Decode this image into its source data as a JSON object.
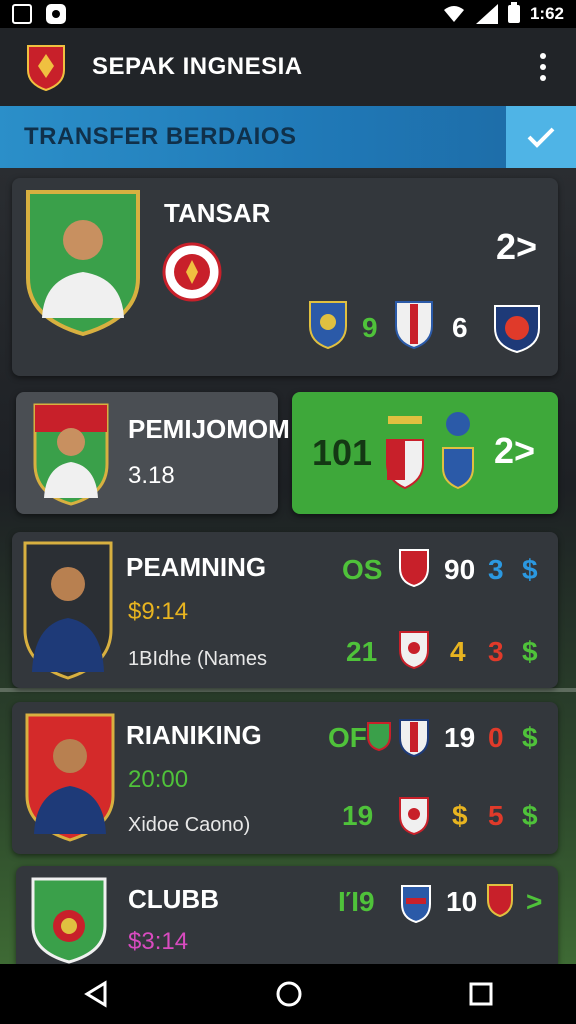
{
  "status_bar": {
    "time": "1:62"
  },
  "app": {
    "title": "SEPAK INGNESIA"
  },
  "banner": {
    "title": "TRANSFER BERDAIOS"
  },
  "cards": [
    {
      "name": "TANSAR",
      "arrow": "2>",
      "stats": [
        "9",
        "6"
      ]
    },
    {
      "name": "PEMIJOMOM",
      "value": "3.18",
      "score": "101",
      "arrow": "2>"
    },
    {
      "name": "PEAMNING",
      "value": "$9:14",
      "note": "1BIdhe (Names",
      "row1": [
        "OS",
        "90",
        "3",
        "$"
      ],
      "row2": [
        "21",
        "4",
        "3",
        "$"
      ]
    },
    {
      "name": "RIANIKING",
      "value": "20:00",
      "note": "Xidoe Caono)",
      "row1": [
        "OF",
        "19",
        "0",
        "$"
      ],
      "row2": [
        "19",
        "$",
        "5",
        "$"
      ]
    },
    {
      "name": "CLUBB",
      "value": "$3:14",
      "row1": [
        "IΊ9",
        "10",
        ">"
      ]
    }
  ],
  "colors": {
    "accent_green": "#4fc23a",
    "banner_blue": "#1f77b5",
    "card_bg": "#33373c"
  }
}
